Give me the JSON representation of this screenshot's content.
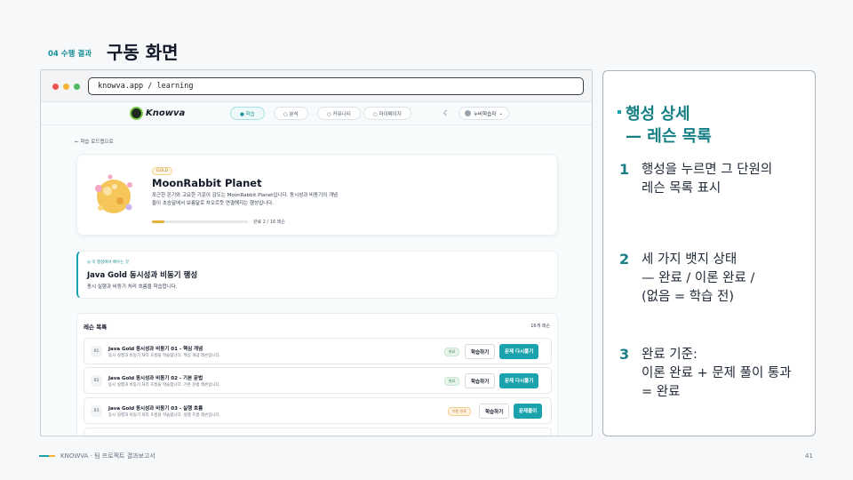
{
  "slide": {
    "section_tag": "04 수행 결과",
    "title": "구동 화면",
    "footer": "KNOWVA · 팀 프로젝트 결과보고서",
    "page_number": "41",
    "accent": "#1aa3ad"
  },
  "browser": {
    "url": "knowva.app / learning"
  },
  "site_nav": {
    "logo": "Knowva",
    "tabs": [
      {
        "label": "● 학습",
        "active": true
      },
      {
        "label": "○ 분석",
        "active": false
      },
      {
        "label": "○ 커뮤니티",
        "active": false
      },
      {
        "label": "○ 마이페이지",
        "active": false
      }
    ],
    "theme_icon": "moon-icon",
    "user": "누비학습자"
  },
  "planet": {
    "back_link": "← 학습 로드맵으로",
    "badge": "GOLD",
    "name": "MoonRabbit Planet",
    "description": "포근한 온기와 고요한 기운이 감도는 MoonRabbit Planet입니다. 동시성과 비동기의 개념들이 초승달에서 보름달로 차오르듯 연결해지는 행성입니다.",
    "progress": 0.125,
    "progress_text": "완료 2 / 16 레슨"
  },
  "lesson_intro": {
    "label": "이 행성에서 배우는 것",
    "title": "Java Gold 동시성과 비동기 행성",
    "description": "동시 실행과 비동기 처리 흐름을 학습합니다."
  },
  "lesson_list": {
    "title": "레슨 목록",
    "count": "16개 레슨",
    "learn_label": "학습하기",
    "lessons": [
      {
        "num": "01",
        "title": "Java Gold 동시성과 비동기 01 - 핵심 개념",
        "desc": "동시 실행과 비동기 처리 흐름을 학습합니다. 핵심 개념 레슨입니다.",
        "badge": "완료",
        "badge_type": "done",
        "quiz": "문제 다시풀기"
      },
      {
        "num": "02",
        "title": "Java Gold 동시성과 비동기 02 - 기본 문법",
        "desc": "동시 실행과 비동기 처리 흐름을 학습합니다. 기본 문법 레슨입니다.",
        "badge": "완료",
        "badge_type": "done",
        "quiz": "문제 다시풀기"
      },
      {
        "num": "03",
        "title": "Java Gold 동시성과 비동기 03 - 실행 흐름",
        "desc": "동시 실행과 비동기 처리 흐름을 학습합니다. 실행 흐름 레슨입니다.",
        "badge": "이론 완료",
        "badge_type": "theory",
        "quiz": "문제풀이"
      }
    ]
  },
  "side": {
    "heading_line1": "행성 상세",
    "heading_line2": "— 레슨 목록",
    "points": [
      {
        "num": "1",
        "text": "행성을 누르면 그 단원의\n레슨 목록 표시"
      },
      {
        "num": "2",
        "text": "세 가지 뱃지 상태\n— 완료 / 이론 완료 /\n(없음 = 학습 전)"
      },
      {
        "num": "3",
        "text": "완료 기준:\n이론 완료 + 문제 풀이 통과\n= 완료"
      }
    ]
  }
}
